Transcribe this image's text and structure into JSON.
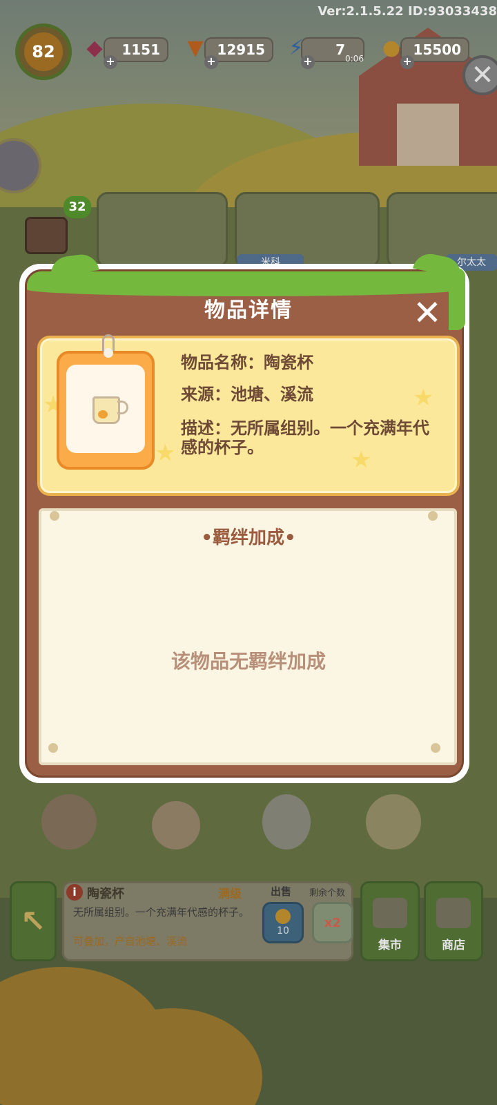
{
  "hud": {
    "version": "Ver:2.1.5.22 ID:93033438",
    "level": "82",
    "gems": "1151",
    "carrots": "12915",
    "energy": "7",
    "energy_timer": "0:06",
    "coins": "15500"
  },
  "background": {
    "order_badge": "32",
    "names": [
      "米科",
      "尔太太"
    ]
  },
  "modal": {
    "title": "物品详情",
    "item_name_line": "物品名称：陶瓷杯",
    "source_line": "来源：池塘、溪流",
    "description_line": "描述：无所属组别。一个充满年代感的杯子。",
    "bond_title": "•羁绊加成•",
    "bond_empty": "该物品无羁绊加成"
  },
  "bottom": {
    "item_name": "陶瓷杯",
    "level_status": "满级",
    "description": "无所属组别。一个充满年代感的杯子。",
    "note": "可叠加，产自池塘、溪流",
    "sell_label": "出售",
    "remain_label": "剩余个数",
    "sell_price": "10",
    "multiplier": "x2",
    "market_label": "集市",
    "shop_label": "商店"
  }
}
